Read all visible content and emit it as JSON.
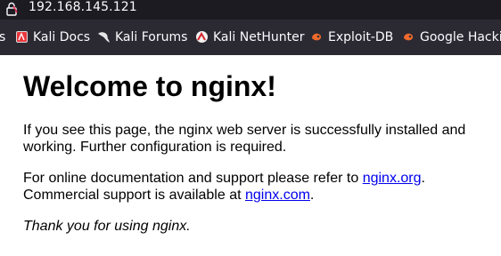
{
  "address_bar": {
    "url": "192.168.145.121"
  },
  "bookmarks": [
    {
      "label": "s",
      "icon": "partial-icon"
    },
    {
      "label": "Kali Docs",
      "icon": "kali-docs-icon"
    },
    {
      "label": "Kali Forums",
      "icon": "kali-dragon-icon"
    },
    {
      "label": "Kali NetHunter",
      "icon": "nethunter-icon"
    },
    {
      "label": "Exploit-DB",
      "icon": "exploit-db-icon"
    },
    {
      "label": "Google Hacking",
      "icon": "ghdb-icon"
    }
  ],
  "page": {
    "heading": "Welcome to nginx!",
    "para1": "If you see this page, the nginx web server is successfully installed and working. Further configuration is required.",
    "para2_prefix": "For online documentation and support please refer to ",
    "link1": "nginx.org",
    "para2_mid": ".",
    "para3_prefix": "Commercial support is available at ",
    "link2": "nginx.com",
    "para3_suffix": ".",
    "thanks": "Thank you for using nginx."
  },
  "colors": {
    "toolbar": "#1c1b22",
    "bookmarks_bar": "#2b2a33",
    "link": "#0000ee"
  }
}
